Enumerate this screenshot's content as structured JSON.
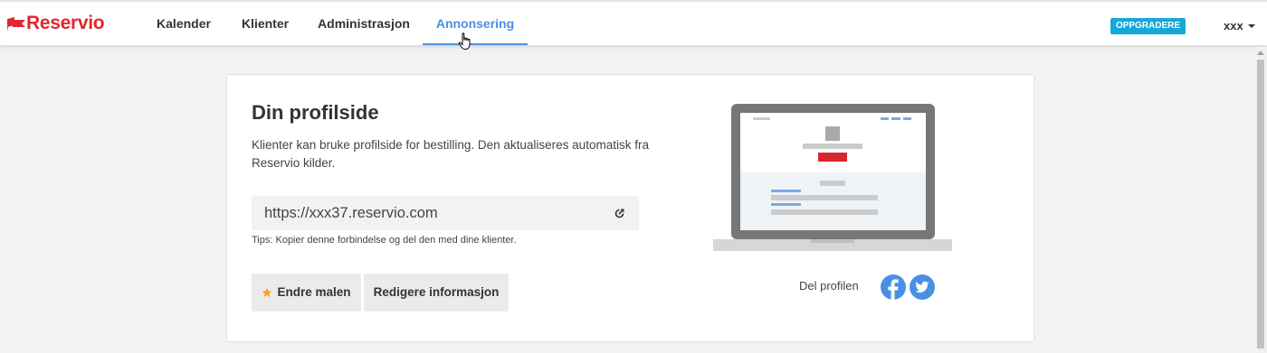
{
  "header": {
    "logo_text": "Reservio",
    "nav": [
      {
        "label": "Kalender"
      },
      {
        "label": "Klienter"
      },
      {
        "label": "Administrasjon"
      },
      {
        "label": "Annonsering"
      }
    ],
    "active_nav": "Annonsering",
    "upgrade_label": "OPPGRADERE",
    "user_label": "xxx"
  },
  "profile": {
    "title": "Din profilside",
    "description": "Klienter kan bruke profilside for bestilling. Den aktualiseres automatisk fra Reservio kilder.",
    "url": "https://xxx37.reservio.com",
    "tip": "Tips: Kopier denne forbindelse og del den med dine klienter.",
    "change_template_label": "Endre malen",
    "edit_info_label": "Redigere informasjon",
    "share_label": "Del profilen"
  },
  "colors": {
    "brand_red": "#e0262e",
    "accent_blue": "#4a90e2",
    "upgrade_bg": "#14a8d8",
    "facebook": "#4a90e2",
    "twitter": "#4a90e2",
    "star": "#f5a623"
  },
  "icons": {
    "logo": "flag-icon",
    "url_action": "external-link-icon",
    "template": "star-icon",
    "social": [
      "facebook-icon",
      "twitter-icon"
    ]
  }
}
